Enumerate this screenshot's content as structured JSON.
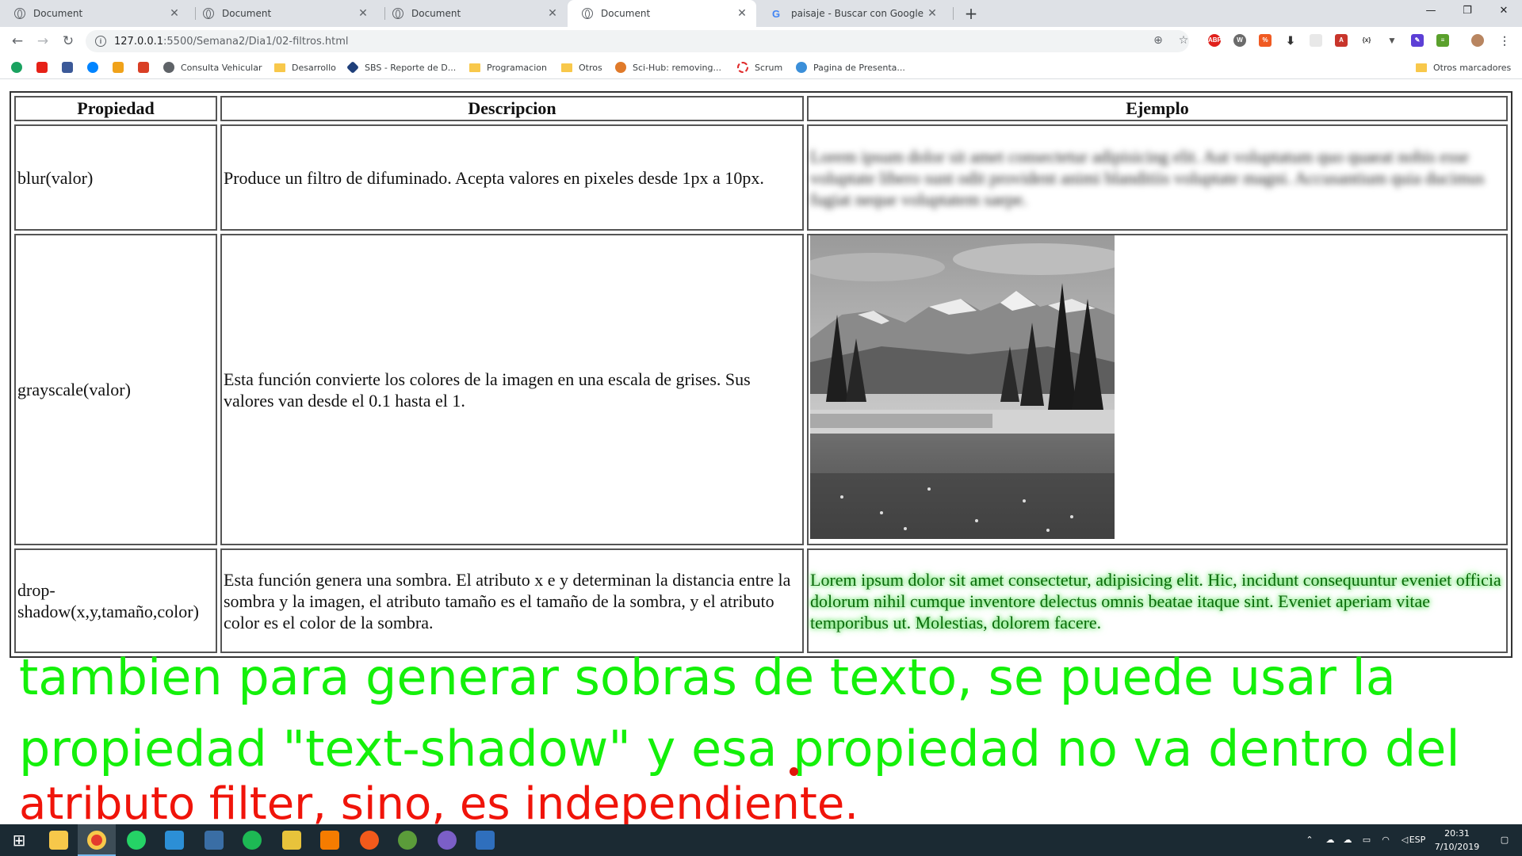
{
  "browser": {
    "tabs": [
      {
        "title": "Document",
        "active": false
      },
      {
        "title": "Document",
        "active": false
      },
      {
        "title": "Document",
        "active": false
      },
      {
        "title": "Document",
        "active": true
      },
      {
        "title": "paisaje - Buscar con Google",
        "active": false
      }
    ],
    "url_host": "127.0.0.1",
    "url_path": ":5500/Semana2/Dia1/02-filtros.html",
    "bookmarks": [
      "Consulta Vehicular",
      "Desarrollo",
      "SBS - Reporte de D...",
      "Programacion",
      "Otros",
      "Sci-Hub: removing...",
      "Scrum",
      "Pagina de Presenta..."
    ],
    "other_bookmarks": "Otros marcadores"
  },
  "table": {
    "headers": [
      "Propiedad",
      "Descripcion",
      "Ejemplo"
    ],
    "rows": [
      {
        "propiedad": "blur(valor)",
        "descripcion": "Produce un filtro de difuminado. Acepta valores en pixeles desde 1px a 10px.",
        "ejemplo": "Lorem ipsum dolor sit amet consectetur adipisicing elit. Aut voluptatum quo quaeat nobis esse voluptate libero sunt odit provident animi blanditiis voluptate magni. Accusantium quia ducimus fugiat neque voluptatem saepe."
      },
      {
        "propiedad": "grayscale(valor)",
        "descripcion": "Esta función convierte los colores de la imagen en una escala de grises. Sus valores van desde el 0.1 hasta el 1.",
        "ejemplo": ""
      },
      {
        "propiedad": "drop-shadow(x,y,tamaño,color)",
        "descripcion": "Esta función genera una sombra. El atributo x e y determinan la distancia entre la sombra y la imagen, el atributo tamaño es el tamaño de la sombra, y el atributo color es el color de la sombra.",
        "ejemplo": "Lorem ipsum dolor sit amet consectetur, adipisicing elit. Hic, incidunt consequuntur eveniet officia dolorum nihil cumque inventore delectus omnis beatae itaque sint. Eveniet aperiam vitae temporibus ut. Molestias, dolorem facere."
      }
    ]
  },
  "annotation": {
    "line1": "tambien para generar sobras de texto, se puede usar la",
    "line2": "propiedad \"text-shadow\" y esa propiedad no va dentro del",
    "line3": "atributo filter, sino, es independiente.",
    "color_green": "#14f00a",
    "color_red": "#f0140a"
  },
  "taskbar": {
    "lang": "ESP",
    "time": "20:31",
    "date": "7/10/2019"
  }
}
